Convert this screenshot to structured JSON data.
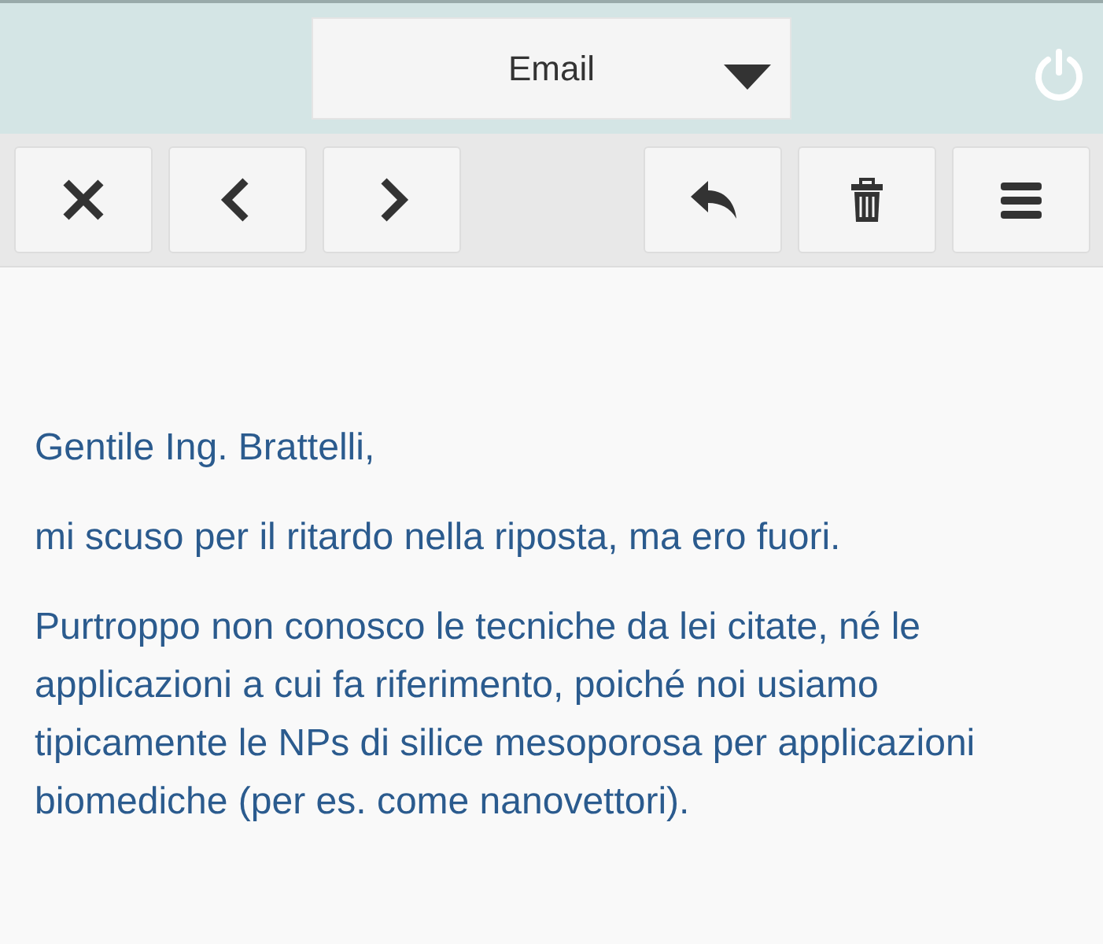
{
  "header": {
    "dropdown": {
      "value": "Email"
    }
  },
  "toolbar": {
    "left": [
      {
        "kind": "close"
      },
      {
        "kind": "prev"
      },
      {
        "kind": "next"
      }
    ],
    "right": [
      {
        "kind": "reply"
      },
      {
        "kind": "trash"
      },
      {
        "kind": "menu"
      }
    ]
  },
  "message": {
    "paragraphs": [
      "Gentile Ing. Brattelli,",
      "mi scuso per il ritardo nella riposta, ma ero fuori.",
      "Purtroppo non conosco le tecniche da lei citate, né le applicazioni a cui fa riferimento, poiché noi usiamo tipicamente le NPs di silice mesoporosa per applicazioni biomediche (per es. come nanovettori)."
    ]
  }
}
